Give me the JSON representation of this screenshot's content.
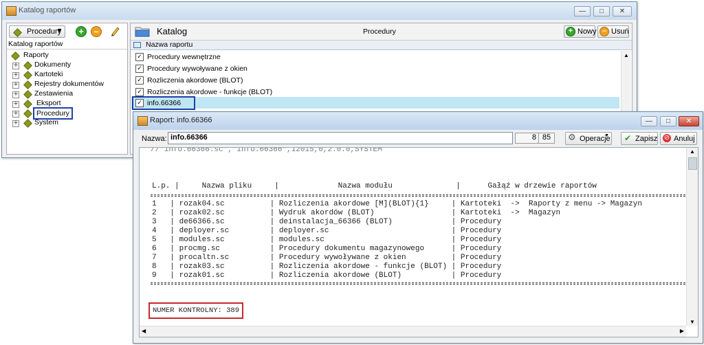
{
  "catalog_window": {
    "title": "Katalog raportów",
    "dropdown_value": "Procedury",
    "tree_header": "Katalog raportów",
    "tree": [
      {
        "label": "Raporty"
      },
      {
        "label": "Dokumenty"
      },
      {
        "label": "Kartoteki"
      },
      {
        "label": "Rejestry dokumentów"
      },
      {
        "label": "Zestawienia"
      },
      {
        "label": "Eksport"
      },
      {
        "label": "Procedury"
      },
      {
        "label": "System"
      }
    ],
    "panel_title": "Katalog",
    "panel_center": "Procedury",
    "new_label": "Nowy",
    "delete_label": "Usuń",
    "column_header": "Nazwa raportu",
    "rows": [
      {
        "label": "Procedury wewnętrzne"
      },
      {
        "label": "Procedury wywoływane z okien"
      },
      {
        "label": "Rozliczenia akordowe (BLOT)"
      },
      {
        "label": "Rozliczenia akordowe - funkcje (BLOT)"
      },
      {
        "label": "info.66366"
      }
    ]
  },
  "report_window": {
    "title": "Raport: info.66366",
    "name_label": "Nazwa:",
    "name_value": "info.66366",
    "line": "8",
    "col": "85",
    "operations_label": "Operacje",
    "save_label": "Zapisz",
    "cancel_label": "Anuluj",
    "code_header_line": "//\"info.66366.sc\",\"info.66366\",12015,0,2.0.0,SYSTEM",
    "columns_line": "L.p. |     Nazwa pliku     |             Nazwa modułu              |      Gałąź w drzewie raportów",
    "table_rows": [
      "1   | rozak04.sc          | Rozliczenia akordowe [M](BLOT){1}     | Kartoteki  ->  Raporty z menu -> Magazyn",
      "2   | rozak02.sc          | Wydruk akordów (BLOT)                 | Kartoteki  ->  Magazyn",
      "3   | de66366.sc          | deinstalacja_66366 (BLOT)             | Procedury",
      "4   | deployer.sc         | deployer.sc                           | Procedury",
      "5   | modules.sc          | modules.sc                            | Procedury",
      "6   | procmg.sc           | Procedury dokumentu magazynowego      | Procedury",
      "7   | procaltn.sc         | Procedury wywoływane z okien          | Procedury",
      "8   | rozak03.sc          | Rozliczenia akordowe - funkcje (BLOT) | Procedury",
      "9   | rozak01.sc          | Rozliczenia akordowe (BLOT)           | Procedury"
    ],
    "control_number": "NUMER KONTROLNY: 389"
  }
}
